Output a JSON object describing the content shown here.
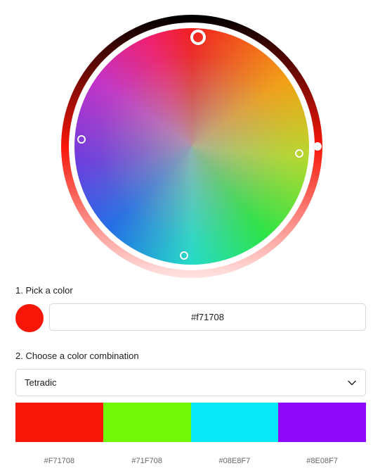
{
  "picker": {
    "selected_hex": "#f71708",
    "selected_color": "#f71708"
  },
  "steps": {
    "pick_label": "1. Pick a color",
    "combo_label": "2. Choose a color combination"
  },
  "combination": {
    "selected": "Tetradic",
    "icon": "chevron-down-icon"
  },
  "palette": [
    {
      "hex": "#F71708",
      "color": "#F71708"
    },
    {
      "hex": "#71F708",
      "color": "#71F708"
    },
    {
      "hex": "#08E8F7",
      "color": "#08E8F7"
    },
    {
      "hex": "#8E08F7",
      "color": "#8E08F7"
    }
  ]
}
